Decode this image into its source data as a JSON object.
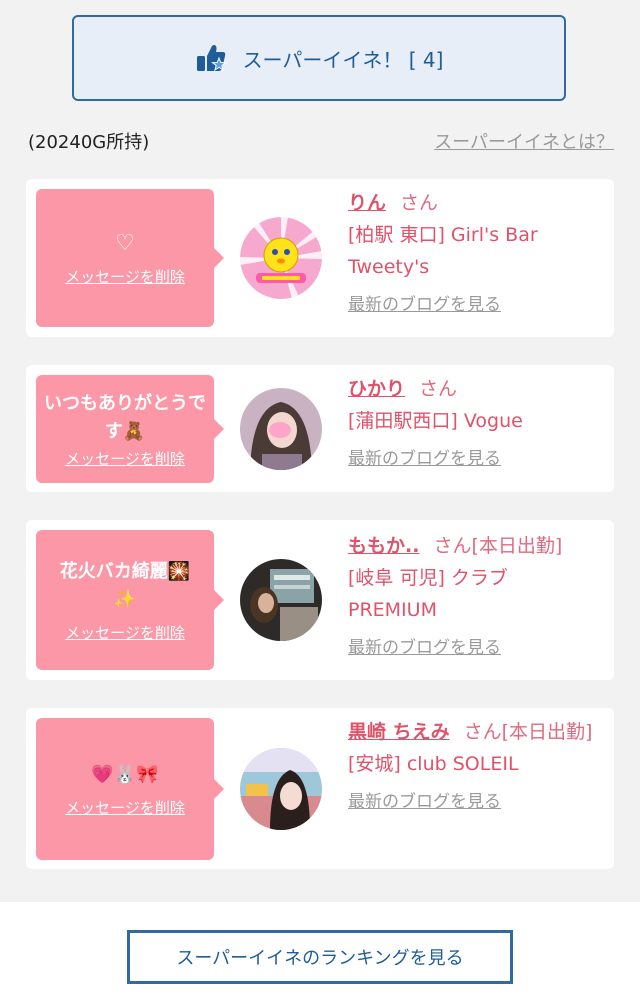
{
  "header": {
    "super_like_label": "スーパーイイネ！ [ 4]",
    "owned": "(20240G所持)",
    "what_link": "スーパーイイネとは？"
  },
  "colors": {
    "accent_blue": "#2f6aa3",
    "bubble_pink": "#fb97a7",
    "name_pink": "#e0526a"
  },
  "cards": [
    {
      "message": "♡",
      "delete_label": "メッセージを削除",
      "name": "りん",
      "suffix": "さん",
      "shop": "[柏駅 東口] Girl's Bar Tweety's",
      "blog_label": "最新のブログを見る",
      "avatar_icon": "tweety-logo-icon"
    },
    {
      "message": "いつもありがとうです🧸",
      "delete_label": "メッセージを削除",
      "name": "ひかり",
      "suffix": "さん",
      "shop": "[蒲田駅西口] Vogue",
      "blog_label": "最新のブログを見る",
      "avatar_icon": "profile-photo-icon"
    },
    {
      "message": "花火バカ綺麗🎇✨",
      "delete_label": "メッセージを削除",
      "name": "ももか..",
      "suffix": "さん[本日出勤]",
      "shop": "[岐阜 可児] クラブ PREMIUM",
      "blog_label": "最新のブログを見る",
      "avatar_icon": "profile-photo-icon"
    },
    {
      "message": "💗🐰🎀",
      "delete_label": "メッセージを削除",
      "name": "黒崎 ちえみ",
      "suffix": "さん[本日出勤]",
      "shop": "[安城] club SOLEIL",
      "blog_label": "最新のブログを見る",
      "avatar_icon": "profile-photo-icon"
    }
  ],
  "footer": {
    "ranking_label": "スーパーイイネのランキングを見る"
  }
}
